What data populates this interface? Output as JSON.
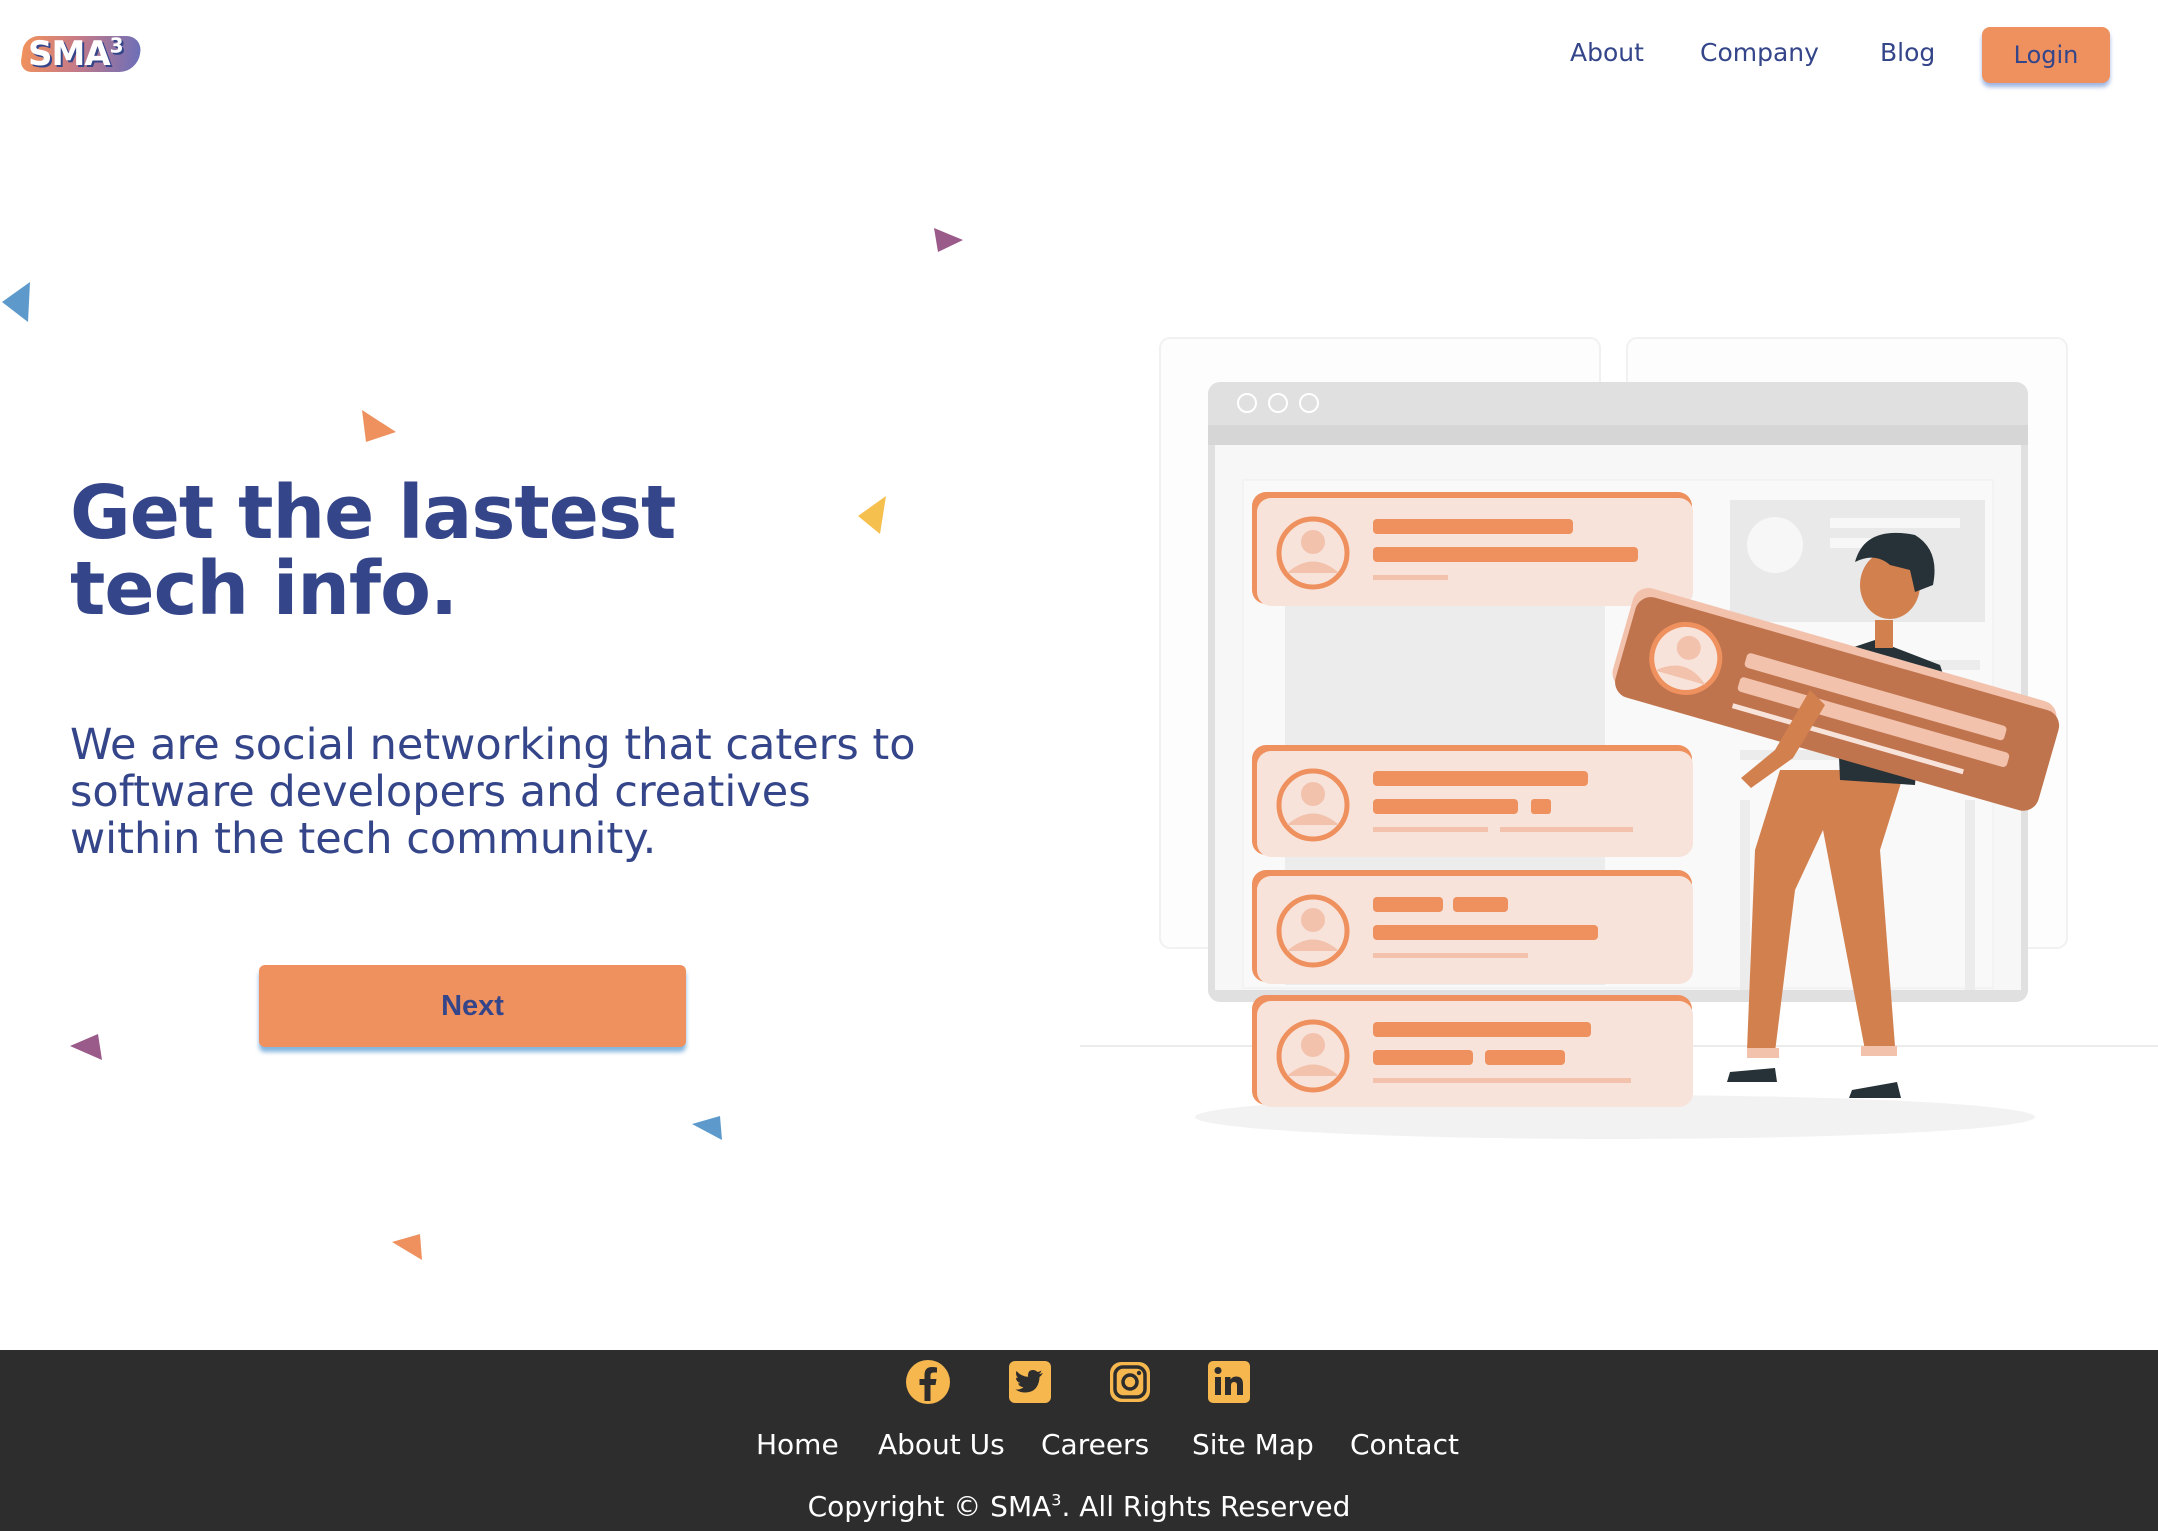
{
  "brand": {
    "logo_text": "SMA",
    "logo_sup": "3"
  },
  "nav": {
    "links": [
      {
        "label": "About"
      },
      {
        "label": "Company"
      },
      {
        "label": "Blog"
      }
    ],
    "login_label": "Login"
  },
  "hero": {
    "title_line1": "Get the lastest",
    "title_line2": "tech info.",
    "subtitle_line1": "We are social networking that caters to",
    "subtitle_line2": "software developers and creatives",
    "subtitle_line3": "within the tech community.",
    "next_label": "Next"
  },
  "footer": {
    "social": [
      {
        "icon": "facebook-icon"
      },
      {
        "icon": "twitter-icon"
      },
      {
        "icon": "instagram-icon"
      },
      {
        "icon": "linkedin-icon"
      }
    ],
    "links": [
      {
        "label": "Home"
      },
      {
        "label": "About Us"
      },
      {
        "label": "Careers"
      },
      {
        "label": "Site Map"
      },
      {
        "label": "Contact"
      }
    ],
    "copyright_prefix": "Copyright © SMA",
    "copyright_sup": "3",
    "copyright_suffix": ". All Rights Reserved"
  },
  "colors": {
    "brand_navy": "#34458a",
    "accent_orange": "#ee915f",
    "footer_bg": "#2d2d2d",
    "social_yellow": "#f5b74e"
  }
}
